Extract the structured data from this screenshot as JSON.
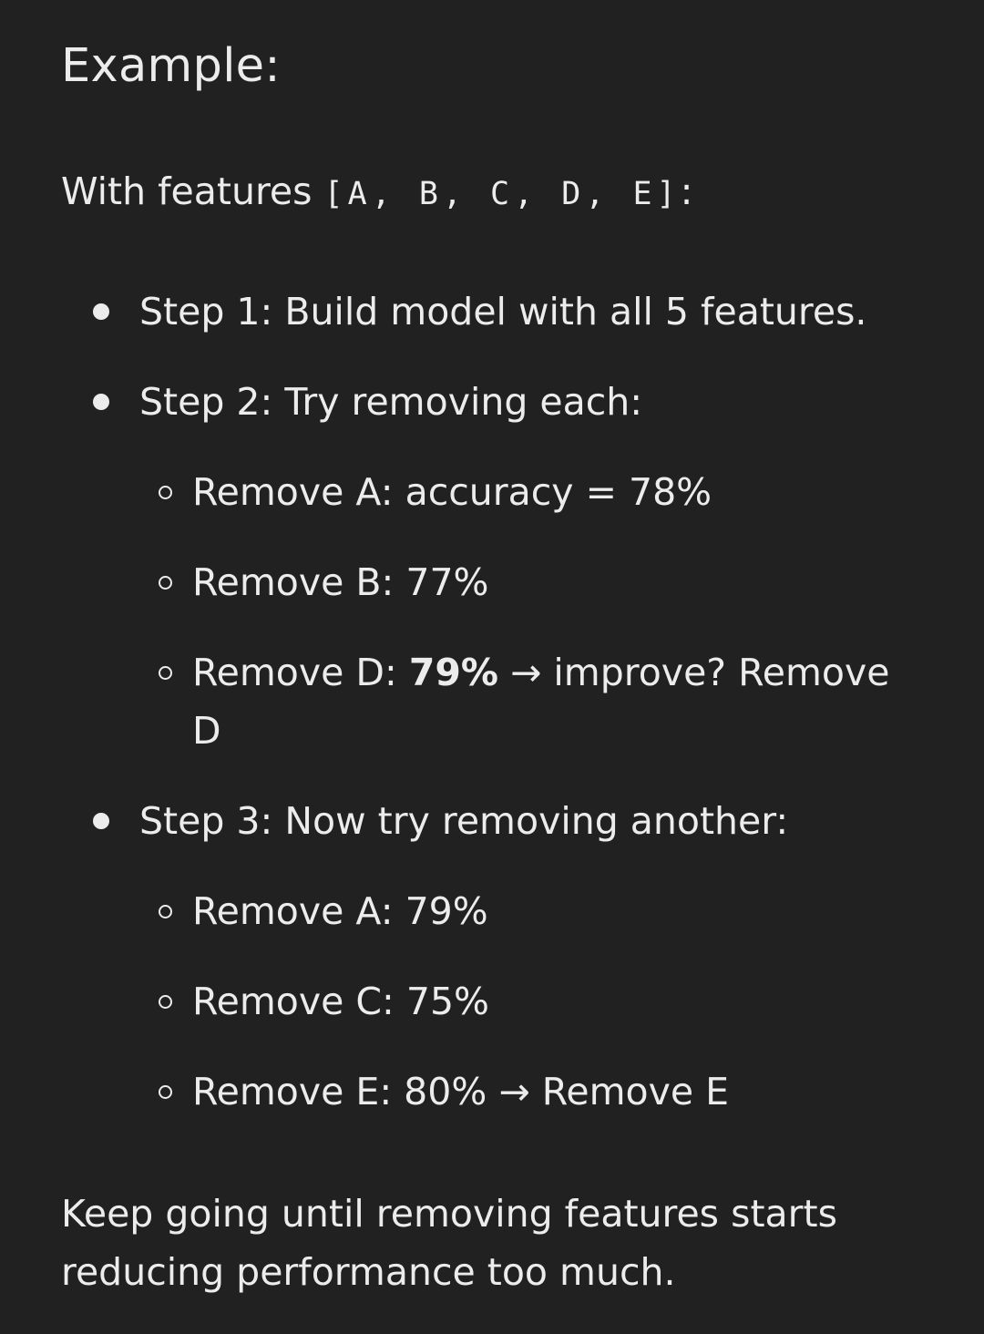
{
  "heading": "Example:",
  "intro": {
    "prefix": "With features ",
    "code": "[A, B, C, D, E]",
    "suffix": ":"
  },
  "steps": [
    {
      "label": "Step 1: Build model with all 5 features.",
      "sub": []
    },
    {
      "label": "Step 2: Try removing each:",
      "sub": [
        {
          "text": "Remove A: accuracy = 78%"
        },
        {
          "text": "Remove B: 77%"
        },
        {
          "pre": "Remove D: ",
          "bold": "79%",
          "post": " → improve? Remove D"
        }
      ]
    },
    {
      "label": "Step 3: Now try removing another:",
      "sub": [
        {
          "text": "Remove A: 79%"
        },
        {
          "text": "Remove C: 75%"
        },
        {
          "text": "Remove E: 80% → Remove E"
        }
      ]
    }
  ],
  "outro": "Keep going until removing features starts reducing performance too much."
}
